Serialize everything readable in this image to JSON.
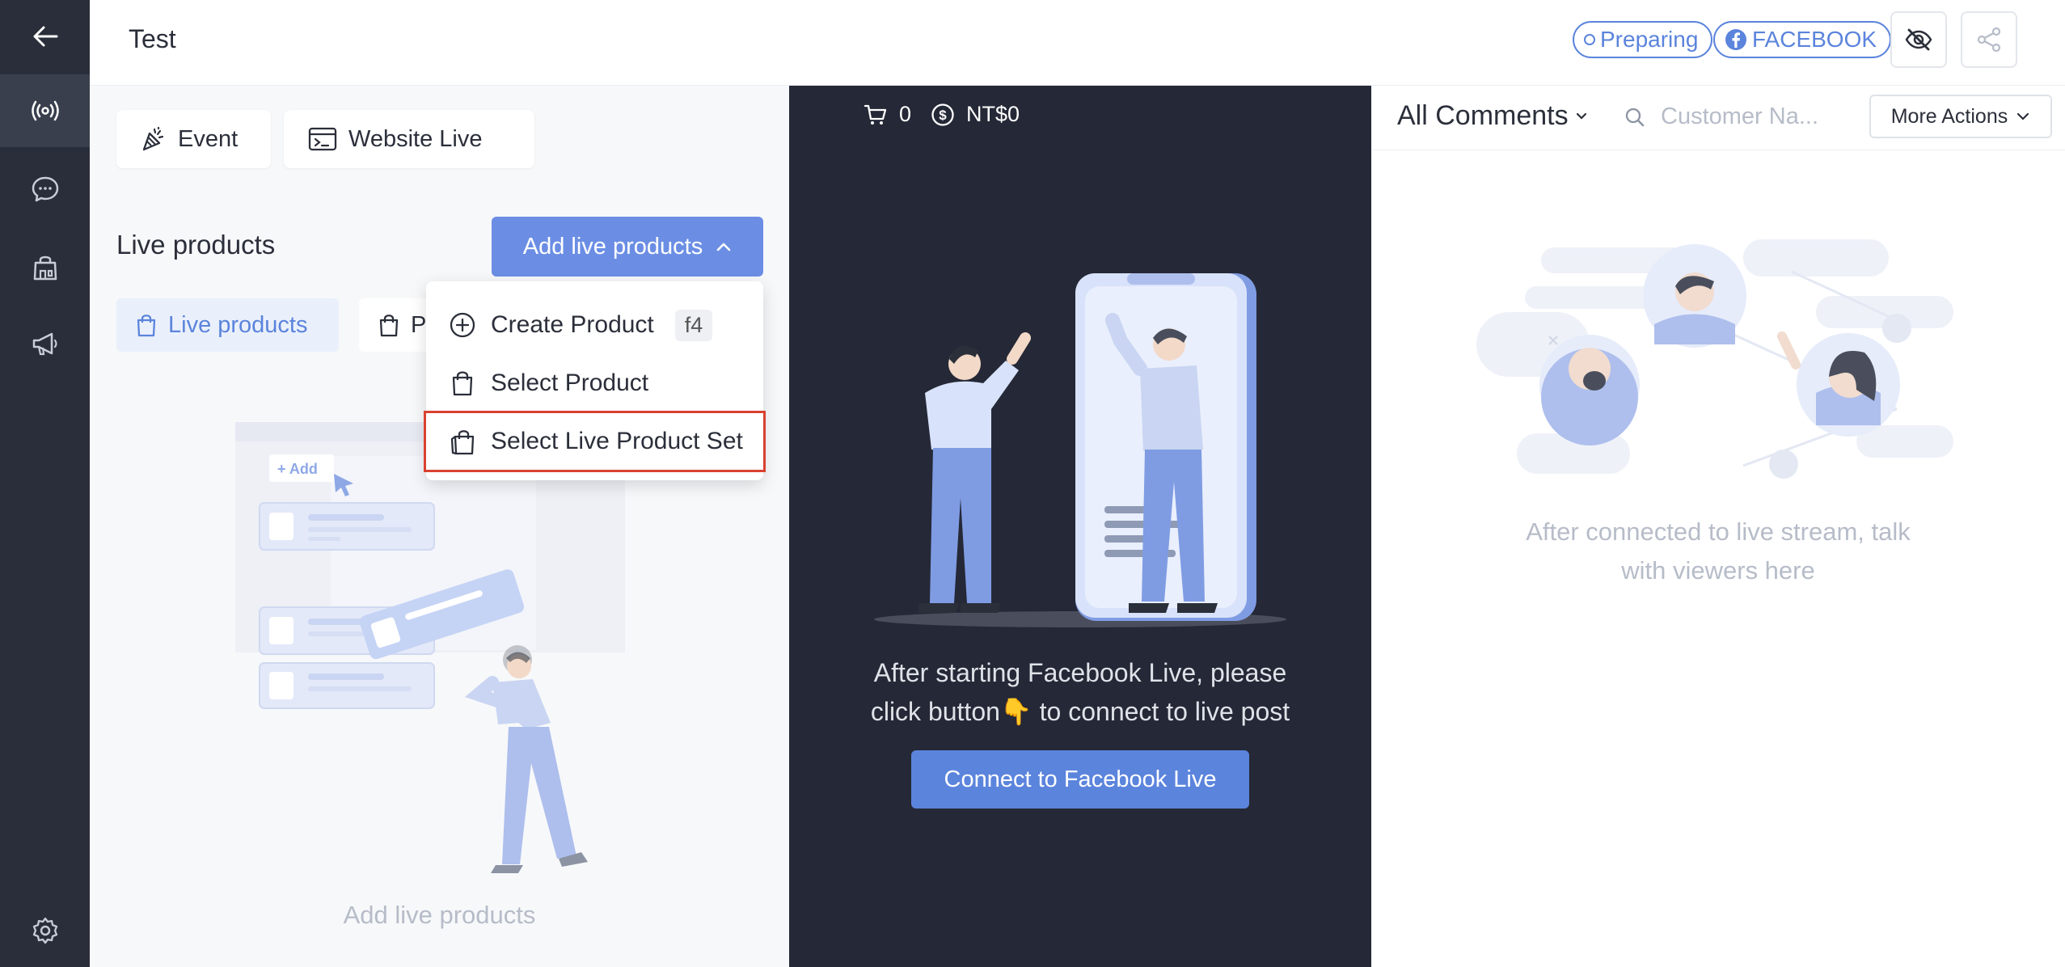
{
  "header": {
    "title": "Test",
    "status_label": "Preparing",
    "platform_label": "FACEBOOK"
  },
  "left_panel": {
    "event_label": "Event",
    "website_live_label": "Website Live",
    "section_title": "Live products",
    "add_button_label": "Add live products",
    "tab_active_label": "Live products",
    "tab_other_label": "P",
    "empty_caption": "Add live products",
    "illustration_add_label": "+ Add"
  },
  "dropdown": {
    "items": [
      {
        "label": "Create Product",
        "shortcut": "f4"
      },
      {
        "label": "Select Product"
      },
      {
        "label": "Select Live Product Set"
      }
    ]
  },
  "center_panel": {
    "cart_count": "0",
    "revenue": "NT$0",
    "message_line1": "After starting Facebook Live, please",
    "message_line2": "click button👇 to connect to live post",
    "connect_button_label": "Connect to Facebook Live"
  },
  "right_panel": {
    "filter_label": "All Comments",
    "search_placeholder": "Customer Na...",
    "more_actions_label": "More Actions",
    "message_line1": "After connected to live stream, talk",
    "message_line2": "with viewers here"
  },
  "colors": {
    "sidebar": "#2a2e3a",
    "accent": "#5b84dc",
    "center_bg": "#252836",
    "highlight": "#d9412f"
  }
}
